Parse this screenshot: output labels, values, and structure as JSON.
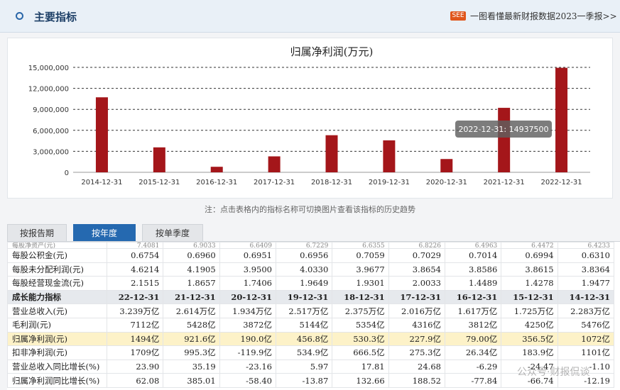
{
  "header": {
    "title": "主要指标",
    "badge": "SEE",
    "link": "一图看懂最新财报数据2023一季报>>"
  },
  "chart_data": {
    "type": "bar",
    "title": "归属净利润(万元)",
    "categories": [
      "2014-12-31",
      "2015-12-31",
      "2016-12-31",
      "2017-12-31",
      "2018-12-31",
      "2019-12-31",
      "2020-12-31",
      "2021-12-31",
      "2022-12-31"
    ],
    "values": [
      10720000,
      3565000,
      790000,
      2279000,
      5303000,
      4568000,
      1900000,
      9216000,
      14937500
    ],
    "ylim": [
      0,
      15000000
    ],
    "yticks": [
      0,
      3000000,
      6000000,
      9000000,
      12000000,
      15000000
    ],
    "ytick_labels": [
      "0",
      "3,000,000",
      "6,000,000",
      "9,000,000",
      "12,000,000",
      "15,000,000"
    ],
    "bar_color": "#a4161a",
    "grid": "dashed horizontal",
    "tooltip": "2022-12-31: 14937500"
  },
  "hint": "注：点击表格内的指标名称可切换图片查看该指标的历史趋势",
  "tabs": [
    {
      "label": "按报告期",
      "active": false
    },
    {
      "label": "按年度",
      "active": true
    },
    {
      "label": "按单季度",
      "active": false
    }
  ],
  "table": {
    "clipped_row": {
      "label": "每股净资产(元)",
      "values": [
        "7.4081",
        "6.9033",
        "6.6409",
        "6.7229",
        "6.6355",
        "6.8226",
        "6.4963",
        "6.4472",
        "6.4233"
      ]
    },
    "rows_top": [
      {
        "label": "每股公积金(元)",
        "values": [
          "0.6754",
          "0.6960",
          "0.6951",
          "0.6956",
          "0.7059",
          "0.7029",
          "0.7014",
          "0.6994",
          "0.6310"
        ]
      },
      {
        "label": "每股未分配利润(元)",
        "values": [
          "4.6214",
          "4.1905",
          "3.9500",
          "4.0330",
          "3.9677",
          "3.8654",
          "3.8586",
          "3.8615",
          "3.8364"
        ]
      },
      {
        "label": "每股经营现金流(元)",
        "values": [
          "2.1515",
          "1.8657",
          "1.7406",
          "1.9649",
          "1.9301",
          "2.0033",
          "1.4489",
          "1.4278",
          "1.9477"
        ]
      }
    ],
    "section": {
      "label": "成长能力指标",
      "values": [
        "22-12-31",
        "21-12-31",
        "20-12-31",
        "19-12-31",
        "18-12-31",
        "17-12-31",
        "16-12-31",
        "15-12-31",
        "14-12-31"
      ]
    },
    "rows_bottom": [
      {
        "label": "营业总收入(元)",
        "values": [
          "3.239万亿",
          "2.614万亿",
          "1.934万亿",
          "2.517万亿",
          "2.375万亿",
          "2.016万亿",
          "1.617万亿",
          "1.725万亿",
          "2.283万亿"
        ]
      },
      {
        "label": "毛利润(元)",
        "values": [
          "7112亿",
          "5428亿",
          "3872亿",
          "5144亿",
          "5354亿",
          "4316亿",
          "3812亿",
          "4250亿",
          "5476亿"
        ]
      },
      {
        "label": "归属净利润(元)",
        "highlight": true,
        "values": [
          "1494亿",
          "921.6亿",
          "190.0亿",
          "456.8亿",
          "530.3亿",
          "227.9亿",
          "79.00亿",
          "356.5亿",
          "1072亿"
        ]
      },
      {
        "label": "扣非净利润(元)",
        "values": [
          "1709亿",
          "995.3亿",
          "-119.9亿",
          "534.9亿",
          "666.5亿",
          "275.3亿",
          "26.34亿",
          "183.9亿",
          "1101亿"
        ]
      },
      {
        "label": "营业总收入同比增长(%)",
        "values": [
          "23.90",
          "35.19",
          "-23.16",
          "5.97",
          "17.81",
          "24.68",
          "-6.29",
          "-24.47",
          "-1.10"
        ]
      },
      {
        "label": "归属净利润同比增长(%)",
        "values": [
          "62.08",
          "385.01",
          "-58.40",
          "-13.87",
          "132.66",
          "188.52",
          "-77.84",
          "-66.74",
          "-12.19"
        ]
      }
    ]
  },
  "watermark": "公众号·财报侃谈"
}
